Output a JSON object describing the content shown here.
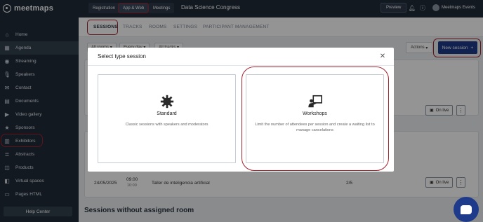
{
  "brand": {
    "name": "meetmaps"
  },
  "sidebar": {
    "items": [
      {
        "label": "Home",
        "icon": "home-icon",
        "glyph": "⌂"
      },
      {
        "label": "Agenda",
        "icon": "calendar-icon",
        "glyph": "▦",
        "active": true
      },
      {
        "label": "Streaming",
        "icon": "broadcast-icon",
        "glyph": "◉"
      },
      {
        "label": "Speakers",
        "icon": "microphone-icon",
        "glyph": "🎙"
      },
      {
        "label": "Contact",
        "icon": "contact-icon",
        "glyph": "✉"
      },
      {
        "label": "Documents",
        "icon": "document-icon",
        "glyph": "▤"
      },
      {
        "label": "Video gallery",
        "icon": "video-icon",
        "glyph": "▶"
      },
      {
        "label": "Sponsors",
        "icon": "sponsor-icon",
        "glyph": "★"
      },
      {
        "label": "Exhibitors",
        "icon": "store-icon",
        "glyph": "▥"
      },
      {
        "label": "Abstracts",
        "icon": "abstract-icon",
        "glyph": "≣"
      },
      {
        "label": "Products",
        "icon": "product-icon",
        "glyph": "◫"
      },
      {
        "label": "Virtual spaces",
        "icon": "virtual-space-icon",
        "glyph": "◧"
      },
      {
        "label": "Pages HTML",
        "icon": "html-page-icon",
        "glyph": "▭"
      }
    ],
    "help_label": "Help Center"
  },
  "topbar": {
    "tabs": [
      "Registration",
      "App & Web",
      "Meetings"
    ],
    "event_title": "Data Science Congress",
    "preview_label": "Preview",
    "user_name": "Meetmaps Events"
  },
  "subtabs": [
    "SESSIONS",
    "TRACKS",
    "ROOMS",
    "SETTINGS",
    "PARTICIPANT MANAGEMENT"
  ],
  "filters": [
    "All rooms",
    "Every day",
    "All tracks"
  ],
  "actions_label": "Actions",
  "new_session_label": "New session",
  "live_label": "On live",
  "session_row": {
    "date": "24/05/2025",
    "start": "09:00",
    "end": "10:00",
    "title": "Taller de inteligencia artificial",
    "count": "2/5"
  },
  "section_title": "Sessions without assigned room",
  "modal": {
    "title": "Select type session",
    "options": [
      {
        "title": "Standard",
        "desc": "Classic sessions with speakers and moderators",
        "icon": "gear-icon"
      },
      {
        "title": "Workshops",
        "desc": "Limit the number of attendees per session and create a waiting list to manage cancelations",
        "icon": "presentation-icon"
      }
    ]
  },
  "colors": {
    "sidebar": "#1f2b3a",
    "primary": "#1e3a8a",
    "highlight": "#a3232f"
  }
}
